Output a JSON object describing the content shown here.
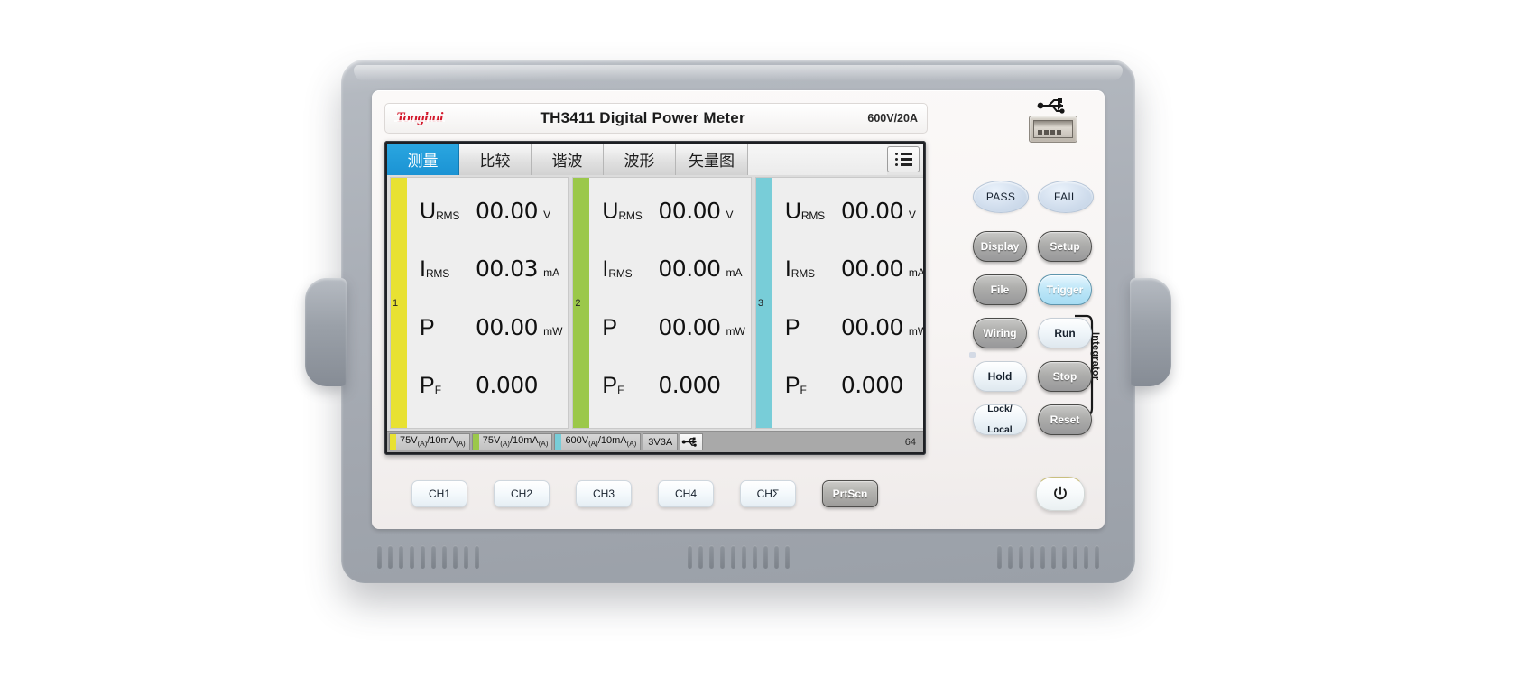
{
  "device": {
    "brand": "Tonghui",
    "model_title": "TH3411 Digital Power Meter",
    "rating": "600V/20A",
    "usb_icon": "usb-icon",
    "power_icon": "power-icon"
  },
  "screen": {
    "tabs": [
      {
        "label": "测量",
        "name": "tab-measure",
        "active": true
      },
      {
        "label": "比较",
        "name": "tab-compare",
        "active": false
      },
      {
        "label": "谐波",
        "name": "tab-harmonics",
        "active": false
      },
      {
        "label": "波形",
        "name": "tab-waveform",
        "active": false
      },
      {
        "label": "矢量图",
        "name": "tab-vector",
        "active": false
      }
    ],
    "menu_icon": "list-menu-icon",
    "channels": [
      {
        "number": "1",
        "color": "#e8e132",
        "rows": [
          {
            "symbol": "U",
            "subscript": "RMS",
            "value": "00.00",
            "unit": "V"
          },
          {
            "symbol": "I",
            "subscript": "RMS",
            "value": "00.03",
            "unit": "mA"
          },
          {
            "symbol": "P",
            "subscript": "",
            "value": "00.00",
            "unit": "mW"
          },
          {
            "symbol": "P",
            "subscript": "F",
            "value": "0.000",
            "unit": ""
          }
        ]
      },
      {
        "number": "2",
        "color": "#9bc84a",
        "rows": [
          {
            "symbol": "U",
            "subscript": "RMS",
            "value": "00.00",
            "unit": "V"
          },
          {
            "symbol": "I",
            "subscript": "RMS",
            "value": "00.00",
            "unit": "mA"
          },
          {
            "symbol": "P",
            "subscript": "",
            "value": "00.00",
            "unit": "mW"
          },
          {
            "symbol": "P",
            "subscript": "F",
            "value": "0.000",
            "unit": ""
          }
        ]
      },
      {
        "number": "3",
        "color": "#78cdd8",
        "rows": [
          {
            "symbol": "U",
            "subscript": "RMS",
            "value": "00.00",
            "unit": "V"
          },
          {
            "symbol": "I",
            "subscript": "RMS",
            "value": "00.00",
            "unit": "mA"
          },
          {
            "symbol": "P",
            "subscript": "",
            "value": "00.00",
            "unit": "mW"
          },
          {
            "symbol": "P",
            "subscript": "F",
            "value": "0.000",
            "unit": ""
          }
        ]
      }
    ],
    "statusbar": {
      "ranges": [
        {
          "color": "#e8e132",
          "volt": "75V",
          "volt_sub": "(A)",
          "amp": "/10mA",
          "amp_sub": "(A)"
        },
        {
          "color": "#9bc84a",
          "volt": "75V",
          "volt_sub": "(A)",
          "amp": "/10mA",
          "amp_sub": "(A)"
        },
        {
          "color": "#78cdd8",
          "volt": "600V",
          "volt_sub": "(A)",
          "amp": "/10mA",
          "amp_sub": "(A)"
        }
      ],
      "wiring_mode": "3V3A",
      "usb_icon": "usb-icon",
      "count": "64"
    }
  },
  "panel": {
    "lamps": [
      {
        "label": "PASS",
        "name": "lamp-pass"
      },
      {
        "label": "FAIL",
        "name": "lamp-fail"
      }
    ],
    "buttons": [
      {
        "label": "Display",
        "name": "display-button",
        "style": "dark"
      },
      {
        "label": "Setup",
        "name": "setup-button",
        "style": "dark"
      },
      {
        "label": "File",
        "name": "file-button",
        "style": "dark"
      },
      {
        "label": "Trigger",
        "name": "trigger-button",
        "style": "blue"
      },
      {
        "label": "Wiring",
        "name": "wiring-button",
        "style": "dark"
      },
      {
        "label": "Run",
        "name": "run-button",
        "style": "light"
      },
      {
        "label": "Hold",
        "name": "hold-button",
        "style": "light"
      },
      {
        "label": "Stop",
        "name": "stop-button",
        "style": "dark"
      },
      {
        "label": "Lock/\nLocal",
        "name": "lock-local-button",
        "style": "light"
      },
      {
        "label": "Reset",
        "name": "reset-button",
        "style": "dark"
      }
    ],
    "integrator_label": "Integrator",
    "channel_buttons": [
      {
        "label": "CH1",
        "name": "ch1-button",
        "style": "light"
      },
      {
        "label": "CH2",
        "name": "ch2-button",
        "style": "light"
      },
      {
        "label": "CH3",
        "name": "ch3-button",
        "style": "light"
      },
      {
        "label": "CH4",
        "name": "ch4-button",
        "style": "light"
      },
      {
        "label": "CHΣ",
        "name": "chsum-button",
        "style": "light"
      },
      {
        "label": "PrtScn",
        "name": "prtscn-button",
        "style": "gray"
      }
    ]
  }
}
